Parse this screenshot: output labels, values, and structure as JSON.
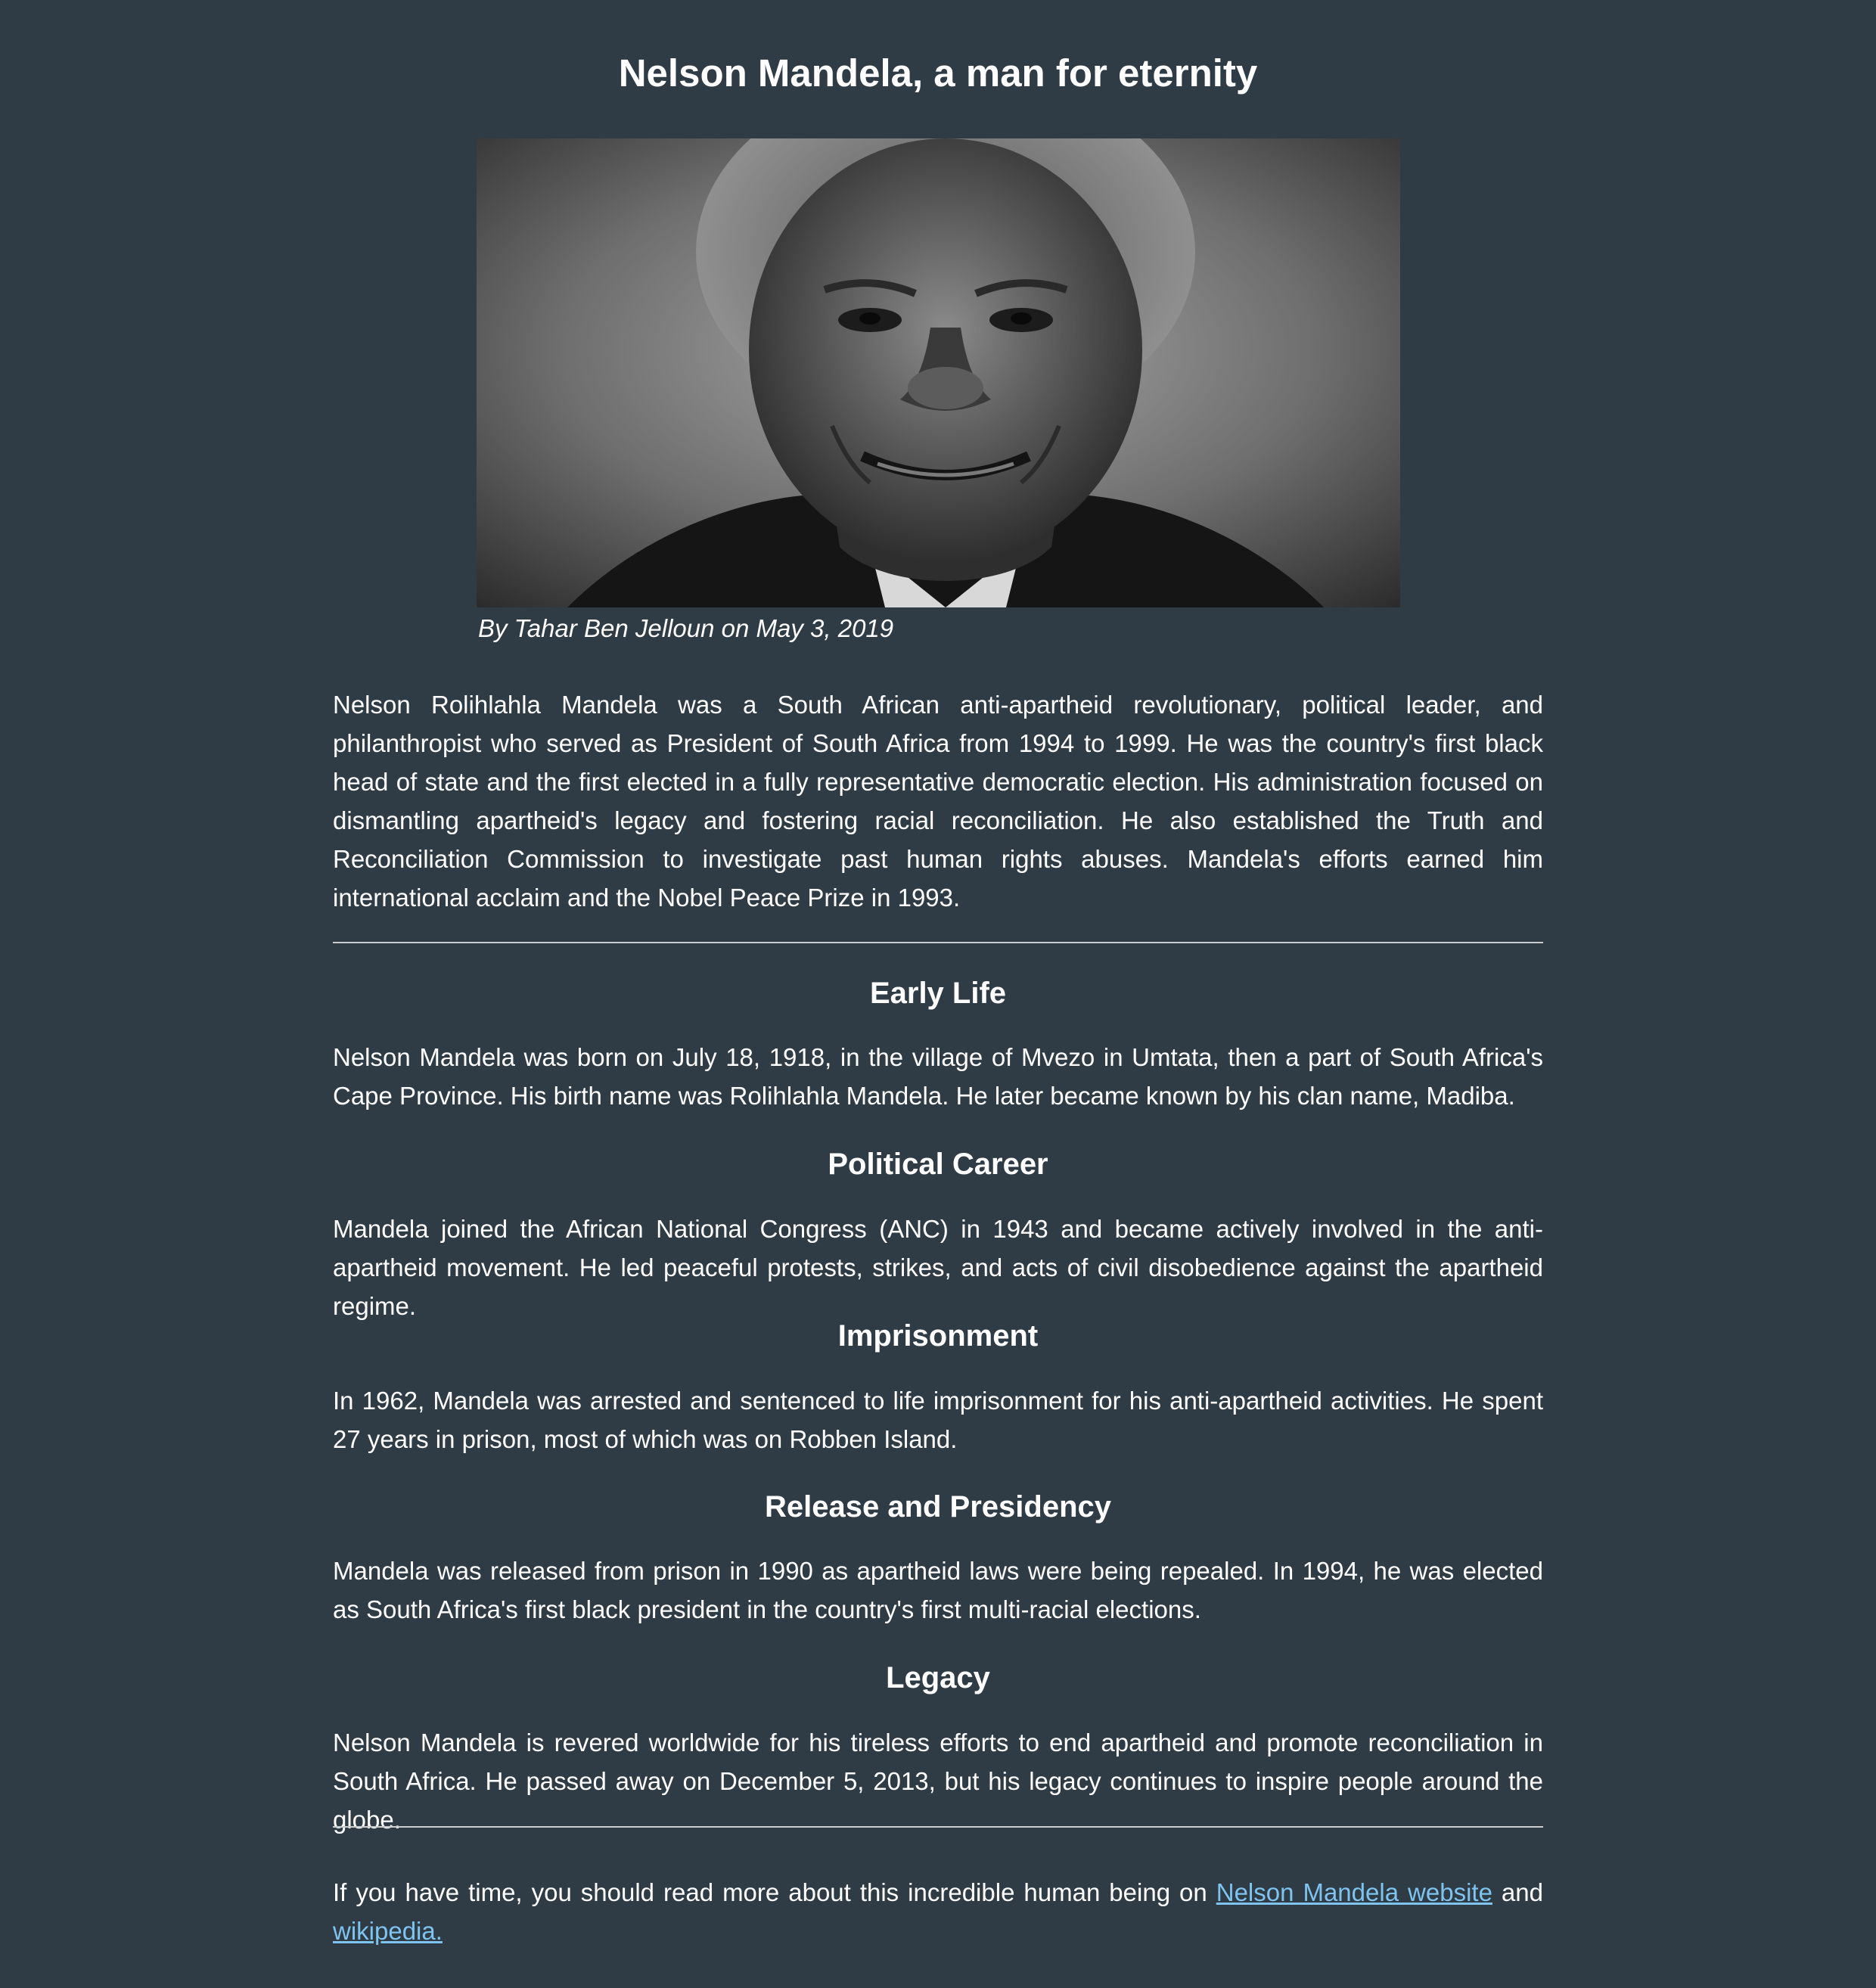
{
  "article": {
    "title": "Nelson Mandela, a man for eternity",
    "byline": "By Tahar Ben Jelloun on May 3, 2019",
    "intro": "Nelson Rolihlahla Mandela was a South African anti-apartheid revolutionary, political leader, and philanthropist who served as President of South Africa from 1994 to 1999. He was the country's first black head of state and the first elected in a fully representative democratic election. His administration focused on dismantling apartheid's legacy and fostering racial reconciliation. He also established the Truth and Reconciliation Commission to investigate past human rights abuses. Mandela's efforts earned him international acclaim and the Nobel Peace Prize in 1993.",
    "sections": [
      {
        "heading": "Early Life",
        "body": "Nelson Mandela was born on July 18, 1918, in the village of Mvezo in Umtata, then a part of South Africa's Cape Province. His birth name was Rolihlahla Mandela. He later became known by his clan name, Madiba."
      },
      {
        "heading": "Political Career",
        "body": "Mandela joined the African National Congress (ANC) in 1943 and became actively involved in the anti-apartheid movement. He led peaceful protests, strikes, and acts of civil disobedience against the apartheid regime."
      },
      {
        "heading": "Imprisonment",
        "body": "In 1962, Mandela was arrested and sentenced to life imprisonment for his anti-apartheid activities. He spent 27 years in prison, most of which was on Robben Island."
      },
      {
        "heading": "Release and Presidency",
        "body": "Mandela was released from prison in 1990 as apartheid laws were being repealed. In 1994, he was elected as South Africa's first black president in the country's first multi-racial elections."
      },
      {
        "heading": "Legacy",
        "body": "Nelson Mandela is revered worldwide for his tireless efforts to end apartheid and promote reconciliation in South Africa. He passed away on December 5, 2013, but his legacy continues to inspire people around the globe."
      }
    ],
    "footer": {
      "text_before": "If you have time, you should read more about this incredible human being on ",
      "link1_label": "Nelson Mandela website",
      "text_between": " and ",
      "link2_label": "wikipedia."
    }
  },
  "colors": {
    "background": "#2f3b45",
    "text": "#ffffff",
    "link": "#7fc4ef",
    "rule": "#c9cdd0"
  }
}
